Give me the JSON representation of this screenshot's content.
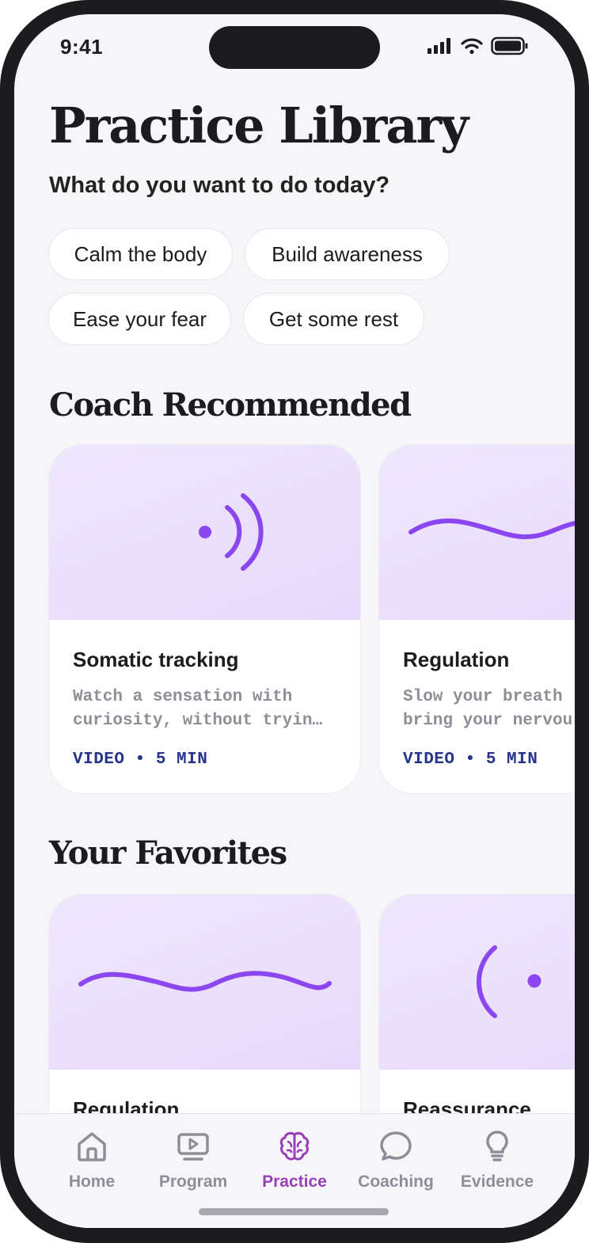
{
  "status": {
    "time": "9:41"
  },
  "page": {
    "title": "Practice Library",
    "subtitle": "What do you want to do today?"
  },
  "filters": [
    "Calm the body",
    "Build awareness",
    "Ease your fear",
    "Get some rest"
  ],
  "sections": {
    "recommended": {
      "title": "Coach Recommended",
      "cards": [
        {
          "title": "Somatic tracking",
          "description": "Watch a sensation with\ncuriosity, without tryin…",
          "meta": "VIDEO • 5 MIN",
          "icon": "sound-waves-icon"
        },
        {
          "title": "Regulation",
          "description": "Slow your breath\nbring your nervou",
          "meta": "VIDEO • 5 MIN",
          "icon": "wave-line-icon"
        }
      ]
    },
    "favorites": {
      "title": "Your Favorites",
      "cards": [
        {
          "title": "Regulation",
          "icon": "wave-line-icon"
        },
        {
          "title": "Reassurance",
          "icon": "arc-dot-icon"
        }
      ]
    }
  },
  "tabbar": {
    "active": "Practice",
    "items": [
      {
        "label": "Home",
        "icon": "home-icon"
      },
      {
        "label": "Program",
        "icon": "video-icon"
      },
      {
        "label": "Practice",
        "icon": "brain-icon"
      },
      {
        "label": "Coaching",
        "icon": "chat-bubble-icon"
      },
      {
        "label": "Evidence",
        "icon": "lightbulb-icon"
      }
    ]
  },
  "colors": {
    "accent": "#8b46f0",
    "active_tab": "#9a3fb8",
    "meta": "#27348b",
    "hero_bg": "#ebe2fd"
  }
}
